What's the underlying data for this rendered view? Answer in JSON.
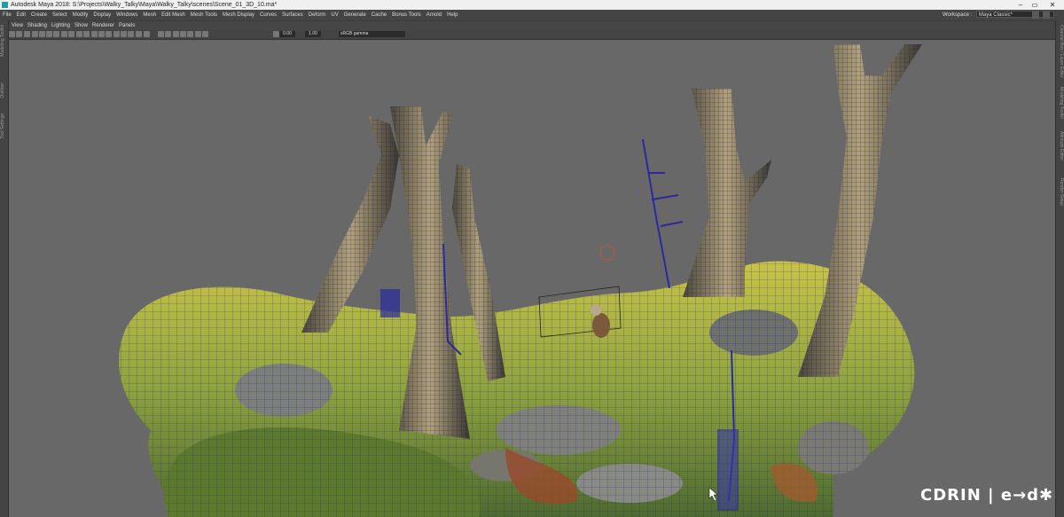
{
  "window": {
    "title": "Autodesk Maya 2018: S:\\Projects\\Walky_Talky\\Maya\\Walky_Talky\\scenes\\Scene_01_3D_10.ma*",
    "minimize": "–",
    "restore": "▭",
    "close": "✕"
  },
  "menubar": {
    "items": [
      "File",
      "Edit",
      "Create",
      "Select",
      "Modify",
      "Display",
      "Windows",
      "Mesh",
      "Edit Mesh",
      "Mesh Tools",
      "Mesh Display",
      "Curves",
      "Surfaces",
      "Deform",
      "UV",
      "Generate",
      "Cache",
      "Bonus Tools",
      "Arnold",
      "Help"
    ],
    "workspace_label": "Workspace :",
    "workspace_value": "Maya Classic*"
  },
  "left_tabs": [
    "Modeling Toolkit",
    "Outliner",
    "Tool Settings"
  ],
  "right_tabs": [
    "Channel Box / Layer Editor",
    "Modeling Toolkit",
    "Attribute Editor",
    "Render Setup"
  ],
  "panel_menu": {
    "items": [
      "View",
      "Shading",
      "Lighting",
      "Show",
      "Renderer",
      "Panels"
    ]
  },
  "toolbar": {
    "field_1": "0.00",
    "field_2": "1.00",
    "colorspace": "sRGB gamma"
  },
  "watermark": {
    "text": "CDRIN | e→d✱"
  },
  "colors": {
    "accent": "#1aa0a5",
    "wireframe": "#2a2aa0",
    "viewport_bg": "#686868"
  }
}
